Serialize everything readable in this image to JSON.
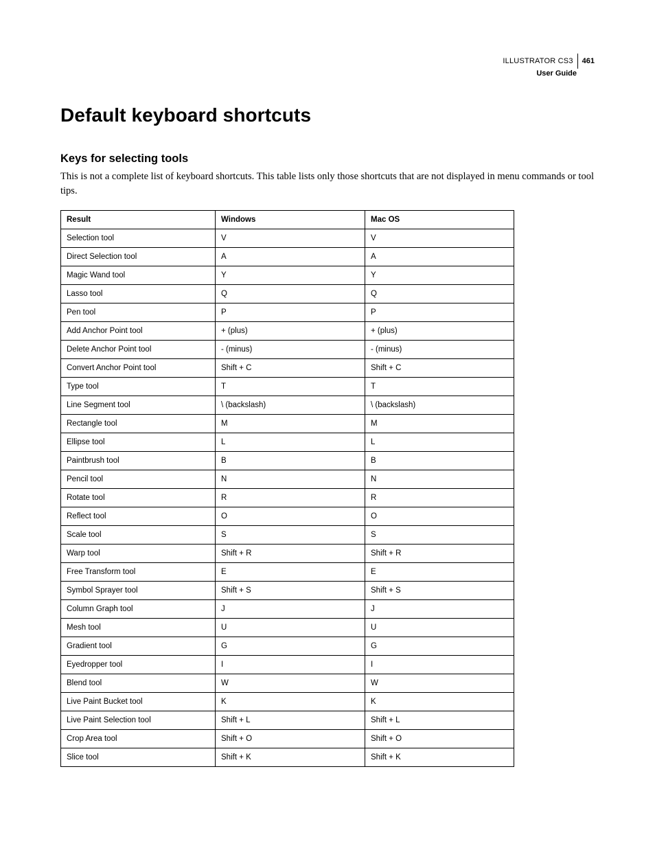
{
  "header": {
    "product": "ILLUSTRATOR CS3",
    "page_number": "461",
    "subtitle": "User Guide"
  },
  "title": "Default keyboard shortcuts",
  "section_title": "Keys for selecting tools",
  "intro": "This is not a complete list of keyboard shortcuts. This table lists only those shortcuts that are not displayed in menu commands or tool tips.",
  "table": {
    "headers": {
      "result": "Result",
      "windows": "Windows",
      "macos": "Mac OS"
    },
    "rows": [
      {
        "result": "Selection tool",
        "windows": "V",
        "macos": "V"
      },
      {
        "result": "Direct Selection tool",
        "windows": "A",
        "macos": "A"
      },
      {
        "result": "Magic Wand tool",
        "windows": "Y",
        "macos": "Y"
      },
      {
        "result": "Lasso tool",
        "windows": "Q",
        "macos": "Q"
      },
      {
        "result": "Pen tool",
        "windows": "P",
        "macos": "P"
      },
      {
        "result": "Add Anchor Point tool",
        "windows": "+ (plus)",
        "macos": "+ (plus)"
      },
      {
        "result": "Delete Anchor Point tool",
        "windows": "- (minus)",
        "macos": "- (minus)"
      },
      {
        "result": "Convert Anchor Point tool",
        "windows": "Shift + C",
        "macos": "Shift + C"
      },
      {
        "result": "Type tool",
        "windows": "T",
        "macos": "T"
      },
      {
        "result": "Line Segment tool",
        "windows": "\\ (backslash)",
        "macos": "\\ (backslash)"
      },
      {
        "result": "Rectangle tool",
        "windows": "M",
        "macos": "M"
      },
      {
        "result": "Ellipse tool",
        "windows": "L",
        "macos": "L"
      },
      {
        "result": "Paintbrush tool",
        "windows": "B",
        "macos": "B"
      },
      {
        "result": "Pencil tool",
        "windows": "N",
        "macos": "N"
      },
      {
        "result": "Rotate tool",
        "windows": "R",
        "macos": "R"
      },
      {
        "result": "Reflect tool",
        "windows": "O",
        "macos": "O"
      },
      {
        "result": "Scale tool",
        "windows": "S",
        "macos": "S"
      },
      {
        "result": "Warp tool",
        "windows": "Shift + R",
        "macos": "Shift + R"
      },
      {
        "result": "Free Transform tool",
        "windows": "E",
        "macos": "E"
      },
      {
        "result": "Symbol Sprayer tool",
        "windows": "Shift + S",
        "macos": "Shift + S"
      },
      {
        "result": "Column Graph tool",
        "windows": "J",
        "macos": "J"
      },
      {
        "result": "Mesh tool",
        "windows": "U",
        "macos": "U"
      },
      {
        "result": "Gradient tool",
        "windows": "G",
        "macos": "G"
      },
      {
        "result": "Eyedropper tool",
        "windows": "I",
        "macos": "I"
      },
      {
        "result": "Blend tool",
        "windows": "W",
        "macos": "W"
      },
      {
        "result": "Live Paint Bucket tool",
        "windows": "K",
        "macos": "K"
      },
      {
        "result": "Live Paint Selection tool",
        "windows": "Shift + L",
        "macos": "Shift + L"
      },
      {
        "result": "Crop Area tool",
        "windows": "Shift + O",
        "macos": "Shift + O"
      },
      {
        "result": "Slice tool",
        "windows": "Shift + K",
        "macos": "Shift + K"
      }
    ]
  }
}
